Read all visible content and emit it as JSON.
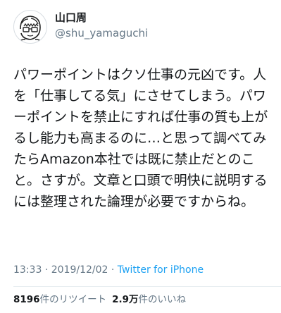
{
  "tweet": {
    "author_name": "山口周",
    "author_handle": "@shu_yamaguchi",
    "text": "パワーポイントはクソ仕事の元凶です。人を「仕事してる気」にさせてしまう。パワーポイントを禁止にすれば仕事の質も上がるし能力も高まるのに…と思って調べてみたらAmazon本社では既に禁止だとのこと。さすが。文章と口頭で明快に説明するには整理された論理が必要ですからね。",
    "time": "13:33",
    "date": "2019/12/02",
    "separator": "·",
    "source": "Twitter for iPhone"
  },
  "stats": {
    "retweets_count": "8196",
    "retweets_label": "件のリツイート",
    "likes_count": "2.9万",
    "likes_label": "件のいいね"
  },
  "colors": {
    "link": "#1da1f2",
    "secondary_text": "#657786",
    "primary_text": "#14171a"
  }
}
